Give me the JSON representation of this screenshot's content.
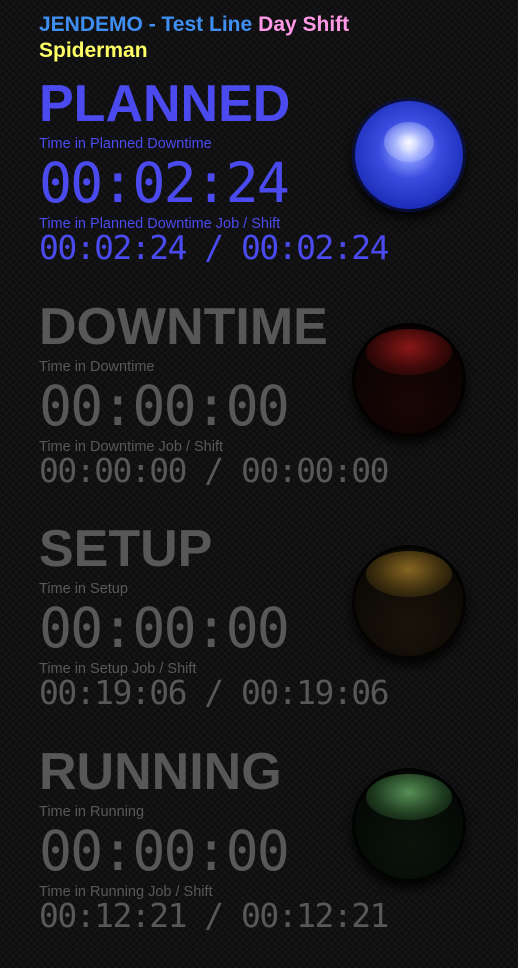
{
  "header": {
    "company": "JENDEMO",
    "separator": " - ",
    "line_name": "Test Line",
    "shift": "Day Shift",
    "operator": "Spiderman"
  },
  "states": [
    {
      "title": "PLANNED",
      "active": true,
      "lamp_color": "blue",
      "label_time": "Time in Planned Downtime",
      "time": "00:02:24",
      "label_job_shift": "Time in Planned Downtime Job / Shift",
      "job_shift": "00:02:24 / 00:02:24"
    },
    {
      "title": "DOWNTIME",
      "active": false,
      "lamp_color": "red",
      "label_time": "Time in Downtime",
      "time": "00:00:00",
      "label_job_shift": "Time in Downtime Job / Shift",
      "job_shift": "00:00:00 / 00:00:00"
    },
    {
      "title": "SETUP",
      "active": false,
      "lamp_color": "yellow",
      "label_time": "Time in Setup",
      "time": "00:00:00",
      "label_job_shift": "Time in Setup Job / Shift",
      "job_shift": "00:19:06 / 00:19:06"
    },
    {
      "title": "RUNNING",
      "active": false,
      "lamp_color": "green",
      "label_time": "Time in Running",
      "time": "00:00:00",
      "label_job_shift": "Time in Running Job / Shift",
      "job_shift": "00:12:21 / 00:12:21"
    }
  ],
  "colors": {
    "active": "#4a4aef",
    "inactive": "#585858",
    "company": "#3f8ef2",
    "shift": "#ff99e6",
    "operator": "#ffff66",
    "background": "#111113"
  }
}
